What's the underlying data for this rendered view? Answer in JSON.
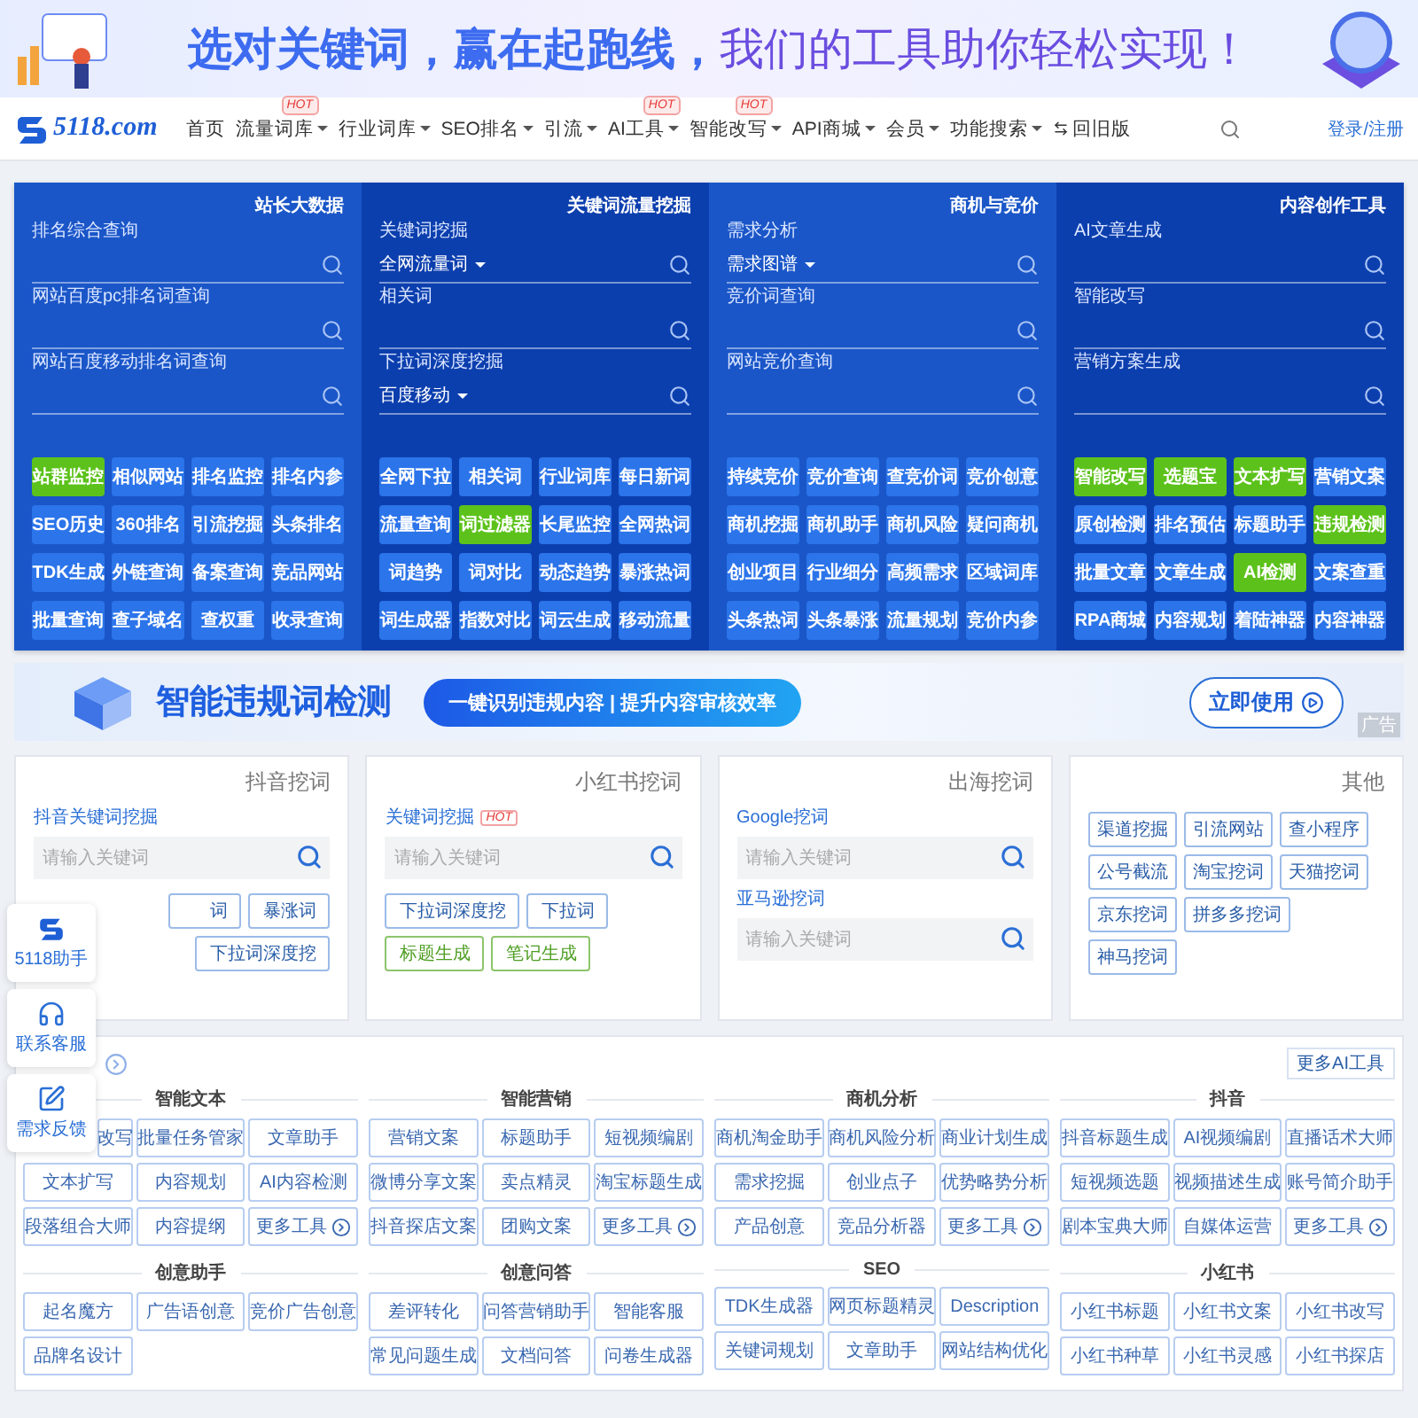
{
  "top_banner": {
    "headline": "选对关键词，赢在起跑线，",
    "headline_accent": "我们的工具助你轻松实现！"
  },
  "nav": {
    "logo": "5118.com",
    "items": [
      {
        "label": "首页",
        "kind": "link",
        "dropdown": false
      },
      {
        "label": "流量词库",
        "kind": "link",
        "dropdown": true,
        "badge": "HOT"
      },
      {
        "label": "行业词库",
        "kind": "link",
        "dropdown": true
      },
      {
        "label": "SEO排名",
        "kind": "link",
        "dropdown": true
      },
      {
        "label": "引流",
        "kind": "link",
        "dropdown": true
      },
      {
        "label": "AI工具",
        "kind": "link",
        "dropdown": true,
        "badge": "HOT"
      },
      {
        "label": "智能改写",
        "kind": "link",
        "dropdown": true,
        "badge": "HOT"
      },
      {
        "label": "API商城",
        "kind": "link",
        "dropdown": true
      },
      {
        "label": "会员",
        "kind": "link",
        "dropdown": true
      },
      {
        "label": "功能搜索",
        "kind": "link",
        "dropdown": true
      },
      {
        "label": "回旧版",
        "kind": "switch",
        "dropdown": false
      }
    ],
    "login": "登录/注册"
  },
  "blue_panel": {
    "columns": [
      {
        "title": "站长大数据",
        "queries": [
          {
            "label": "排名综合查询"
          },
          {
            "label": "网站百度pc排名词查询"
          },
          {
            "label": "网站百度移动排名词查询"
          }
        ],
        "tools": [
          {
            "label": "站群监控",
            "highlighted": true
          },
          {
            "label": "相似网站",
            "highlighted": false
          },
          {
            "label": "排名监控",
            "highlighted": false
          },
          {
            "label": "排名内参",
            "highlighted": false
          },
          {
            "label": "SEO历史",
            "highlighted": false
          },
          {
            "label": "360排名",
            "highlighted": false
          },
          {
            "label": "引流挖掘",
            "highlighted": false
          },
          {
            "label": "头条排名",
            "highlighted": false
          },
          {
            "label": "TDK生成",
            "highlighted": false
          },
          {
            "label": "外链查询",
            "highlighted": false
          },
          {
            "label": "备案查询",
            "highlighted": false
          },
          {
            "label": "竞品网站",
            "highlighted": false
          },
          {
            "label": "批量查询",
            "highlighted": false
          },
          {
            "label": "查子域名",
            "highlighted": false
          },
          {
            "label": "查权重",
            "highlighted": false
          },
          {
            "label": "收录查询",
            "highlighted": false
          }
        ]
      },
      {
        "title": "关键词流量挖掘",
        "queries": [
          {
            "label": "关键词挖掘",
            "option": "全网流量词"
          },
          {
            "label": "相关词"
          },
          {
            "label": "下拉词深度挖掘",
            "option": "百度移动"
          }
        ],
        "tools": [
          {
            "label": "全网下拉",
            "highlighted": false
          },
          {
            "label": "相关词",
            "highlighted": false
          },
          {
            "label": "行业词库",
            "highlighted": false
          },
          {
            "label": "每日新词",
            "highlighted": false
          },
          {
            "label": "流量查询",
            "highlighted": false
          },
          {
            "label": "词过滤器",
            "highlighted": true
          },
          {
            "label": "长尾监控",
            "highlighted": false
          },
          {
            "label": "全网热词",
            "highlighted": false
          },
          {
            "label": "词趋势",
            "highlighted": false
          },
          {
            "label": "词对比",
            "highlighted": false
          },
          {
            "label": "动态趋势",
            "highlighted": false
          },
          {
            "label": "暴涨热词",
            "highlighted": false
          },
          {
            "label": "词生成器",
            "highlighted": false
          },
          {
            "label": "指数对比",
            "highlighted": false
          },
          {
            "label": "词云生成",
            "highlighted": false
          },
          {
            "label": "移动流量",
            "highlighted": false
          }
        ]
      },
      {
        "title": "商机与竞价",
        "queries": [
          {
            "label": "需求分析",
            "option": "需求图谱"
          },
          {
            "label": "竞价词查询"
          },
          {
            "label": "网站竞价查询"
          }
        ],
        "tools": [
          {
            "label": "持续竞价",
            "highlighted": false
          },
          {
            "label": "竞价查询",
            "highlighted": false
          },
          {
            "label": "查竞价词",
            "highlighted": false
          },
          {
            "label": "竞价创意",
            "highlighted": false
          },
          {
            "label": "商机挖掘",
            "highlighted": false
          },
          {
            "label": "商机助手",
            "highlighted": false
          },
          {
            "label": "商机风险",
            "highlighted": false
          },
          {
            "label": "疑问商机",
            "highlighted": false
          },
          {
            "label": "创业项目",
            "highlighted": false
          },
          {
            "label": "行业细分",
            "highlighted": false
          },
          {
            "label": "高频需求",
            "highlighted": false
          },
          {
            "label": "区域词库",
            "highlighted": false
          },
          {
            "label": "头条热词",
            "highlighted": false
          },
          {
            "label": "头条暴涨",
            "highlighted": false
          },
          {
            "label": "流量规划",
            "highlighted": false
          },
          {
            "label": "竞价内参",
            "highlighted": false
          }
        ]
      },
      {
        "title": "内容创作工具",
        "queries": [
          {
            "label": "AI文章生成"
          },
          {
            "label": "智能改写"
          },
          {
            "label": "营销方案生成"
          }
        ],
        "tools": [
          {
            "label": "智能改写",
            "highlighted": true
          },
          {
            "label": "选题宝",
            "highlighted": true
          },
          {
            "label": "文本扩写",
            "highlighted": true
          },
          {
            "label": "营销文案",
            "highlighted": false
          },
          {
            "label": "原创检测",
            "highlighted": false
          },
          {
            "label": "排名预估",
            "highlighted": false
          },
          {
            "label": "标题助手",
            "highlighted": false
          },
          {
            "label": "违规检测",
            "highlighted": true
          },
          {
            "label": "批量文章",
            "highlighted": false
          },
          {
            "label": "文章生成",
            "highlighted": false
          },
          {
            "label": "AI检测",
            "highlighted": true
          },
          {
            "label": "文案查重",
            "highlighted": false
          },
          {
            "label": "RPA商城",
            "highlighted": false
          },
          {
            "label": "内容规划",
            "highlighted": false
          },
          {
            "label": "着陆神器",
            "highlighted": false
          },
          {
            "label": "内容神器",
            "highlighted": false
          }
        ]
      }
    ]
  },
  "promo": {
    "title": "智能违规词检测",
    "tagline": "一键识别违规内容 | 提升内容审核效率",
    "button": "立即使用",
    "ad_tag": "广告"
  },
  "cards": [
    {
      "title": "抖音挖词",
      "fields": [
        {
          "label": "抖音关键词挖掘",
          "placeholder": "请输入关键词"
        }
      ],
      "buttons": [
        {
          "label": "词",
          "accent": false
        },
        {
          "label": "暴涨词",
          "accent": false
        },
        {
          "label": "下拉词深度挖",
          "accent": false
        }
      ]
    },
    {
      "title": "小红书挖词",
      "fields": [
        {
          "label": "关键词挖掘",
          "badge": "HOT",
          "placeholder": "请输入关键词"
        }
      ],
      "buttons": [
        {
          "label": "下拉词深度挖",
          "accent": false
        },
        {
          "label": "下拉词",
          "accent": false
        },
        {
          "label": "标题生成",
          "accent": true
        },
        {
          "label": "笔记生成",
          "accent": true
        }
      ]
    },
    {
      "title": "出海挖词",
      "fields": [
        {
          "label": "Google挖词",
          "placeholder": "请输入关键词"
        },
        {
          "label": "亚马逊挖词",
          "placeholder": "请输入关键词"
        }
      ]
    },
    {
      "title": "其他",
      "tags": [
        "渠道挖掘",
        "引流网站",
        "查小程序",
        "公号截流",
        "淘宝挖词",
        "天猫挖词",
        "京东挖词",
        "拼多多挖词",
        "神马挖词"
      ]
    }
  ],
  "float_bar": [
    {
      "label": "5118助手",
      "kind": "assistant"
    },
    {
      "label": "联系客服",
      "kind": "service"
    },
    {
      "label": "需求反馈",
      "kind": "feedback"
    }
  ],
  "ai_tools": {
    "more": "更多AI工具",
    "groups": [
      {
        "title": "智能文本",
        "tools": [
          {
            "label": "改写",
            "kind": "tool"
          },
          {
            "label": "批量任务管家",
            "kind": "tool"
          },
          {
            "label": "文章助手",
            "kind": "tool"
          },
          {
            "label": "文本扩写",
            "kind": "tool"
          },
          {
            "label": "内容规划",
            "kind": "tool"
          },
          {
            "label": "AI内容检测",
            "kind": "tool"
          },
          {
            "label": "段落组合大师",
            "kind": "tool"
          },
          {
            "label": "内容提纲",
            "kind": "tool"
          },
          {
            "label": "更多工具",
            "kind": "more"
          }
        ]
      },
      {
        "title": "智能营销",
        "tools": [
          {
            "label": "营销文案",
            "kind": "tool"
          },
          {
            "label": "标题助手",
            "kind": "tool"
          },
          {
            "label": "短视频编剧",
            "kind": "tool"
          },
          {
            "label": "微博分享文案",
            "kind": "tool"
          },
          {
            "label": "卖点精灵",
            "kind": "tool"
          },
          {
            "label": "淘宝标题生成",
            "kind": "tool"
          },
          {
            "label": "抖音探店文案",
            "kind": "tool"
          },
          {
            "label": "团购文案",
            "kind": "tool"
          },
          {
            "label": "更多工具",
            "kind": "more"
          }
        ]
      },
      {
        "title": "商机分析",
        "tools": [
          {
            "label": "商机淘金助手",
            "kind": "tool"
          },
          {
            "label": "商机风险分析",
            "kind": "tool"
          },
          {
            "label": "商业计划生成",
            "kind": "tool"
          },
          {
            "label": "需求挖掘",
            "kind": "tool"
          },
          {
            "label": "创业点子",
            "kind": "tool"
          },
          {
            "label": "优势略势分析",
            "kind": "tool"
          },
          {
            "label": "产品创意",
            "kind": "tool"
          },
          {
            "label": "竞品分析器",
            "kind": "tool"
          },
          {
            "label": "更多工具",
            "kind": "more"
          }
        ]
      },
      {
        "title": "抖音",
        "tools": [
          {
            "label": "抖音标题生成",
            "kind": "tool"
          },
          {
            "label": "AI视频编剧",
            "kind": "tool"
          },
          {
            "label": "直播话术大师",
            "kind": "tool"
          },
          {
            "label": "短视频选题",
            "kind": "tool"
          },
          {
            "label": "视频描述生成",
            "kind": "tool"
          },
          {
            "label": "账号简介助手",
            "kind": "tool"
          },
          {
            "label": "剧本宝典大师",
            "kind": "tool"
          },
          {
            "label": "自媒体运营",
            "kind": "tool"
          },
          {
            "label": "更多工具",
            "kind": "more"
          }
        ]
      },
      {
        "title": "创意助手",
        "tools": [
          {
            "label": "起名魔方",
            "kind": "tool"
          },
          {
            "label": "广告语创意",
            "kind": "tool"
          },
          {
            "label": "竞价广告创意",
            "kind": "tool"
          },
          {
            "label": "品牌名设计",
            "kind": "tool"
          }
        ]
      },
      {
        "title": "创意问答",
        "tools": [
          {
            "label": "差评转化",
            "kind": "tool"
          },
          {
            "label": "问答营销助手",
            "kind": "tool"
          },
          {
            "label": "智能客服",
            "kind": "tool"
          },
          {
            "label": "常见问题生成",
            "kind": "tool"
          },
          {
            "label": "文档问答",
            "kind": "tool"
          },
          {
            "label": "问卷生成器",
            "kind": "tool"
          }
        ]
      },
      {
        "title": "SEO",
        "tools": [
          {
            "label": "TDK生成器",
            "kind": "tool"
          },
          {
            "label": "网页标题精灵",
            "kind": "tool"
          },
          {
            "label": "Description",
            "kind": "tool"
          },
          {
            "label": "关键词规划",
            "kind": "tool"
          },
          {
            "label": "文章助手",
            "kind": "tool"
          },
          {
            "label": "网站结构优化",
            "kind": "tool"
          }
        ]
      },
      {
        "title": "小红书",
        "tools": [
          {
            "label": "小红书标题",
            "kind": "tool"
          },
          {
            "label": "小红书文案",
            "kind": "tool"
          },
          {
            "label": "小红书改写",
            "kind": "tool"
          },
          {
            "label": "小红书种草",
            "kind": "tool"
          },
          {
            "label": "小红书灵感",
            "kind": "tool"
          },
          {
            "label": "小红书探店",
            "kind": "tool"
          }
        ]
      }
    ]
  }
}
